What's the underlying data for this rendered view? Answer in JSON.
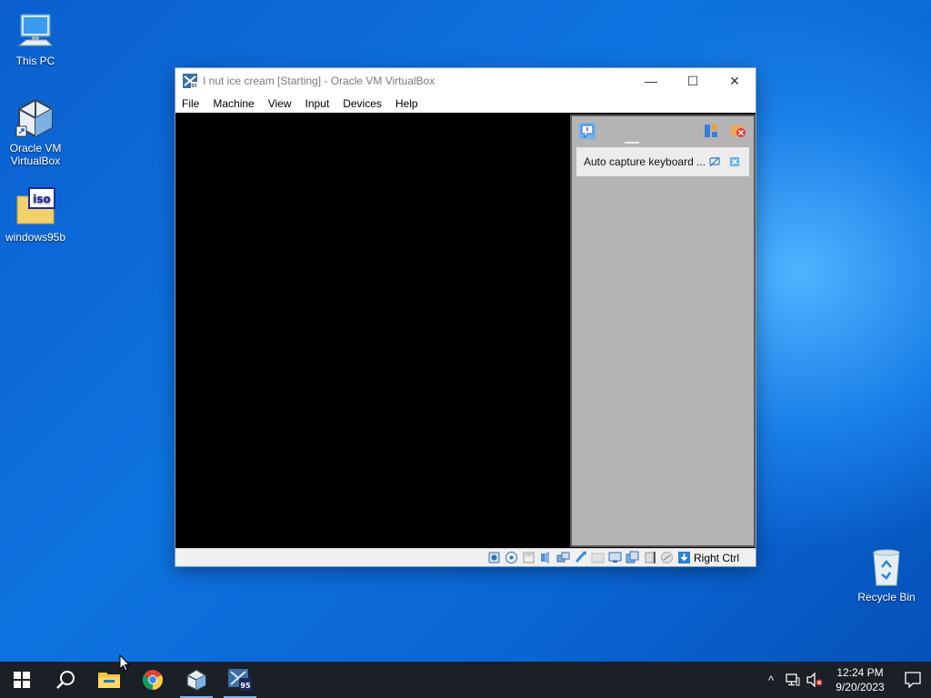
{
  "desktop": {
    "icons": [
      {
        "label": "This PC",
        "icon": "this-pc-icon"
      },
      {
        "label": "Oracle VM VirtualBox",
        "icon": "virtualbox-icon"
      },
      {
        "label": "windows95b",
        "icon": "iso-file-icon"
      },
      {
        "label": "Recycle Bin",
        "icon": "recycle-bin-icon"
      }
    ]
  },
  "window": {
    "title": "I nut ice cream [Starting] - Oracle VM VirtualBox",
    "controls": {
      "minimize": "—",
      "maximize": "☐",
      "close": "✕"
    },
    "menu": [
      "File",
      "Machine",
      "View",
      "Input",
      "Devices",
      "Help"
    ],
    "notification": {
      "message": "Auto capture keyboard ..."
    },
    "statusbar": {
      "host_key": "Right Ctrl"
    }
  },
  "taskbar": {
    "pinned": [
      "start-icon",
      "search-icon",
      "file-explorer-icon",
      "chrome-icon",
      "virtualbox-icon",
      "windows95-vm-icon"
    ],
    "clock": {
      "time": "12:24 PM",
      "date": "9/20/2023"
    },
    "tray_chevron": "^"
  },
  "colors": {
    "taskbar_bg": "#1b1f26",
    "desktop_blue": "#0e73e0",
    "notice_panel_bg": "#b4b4b4"
  }
}
